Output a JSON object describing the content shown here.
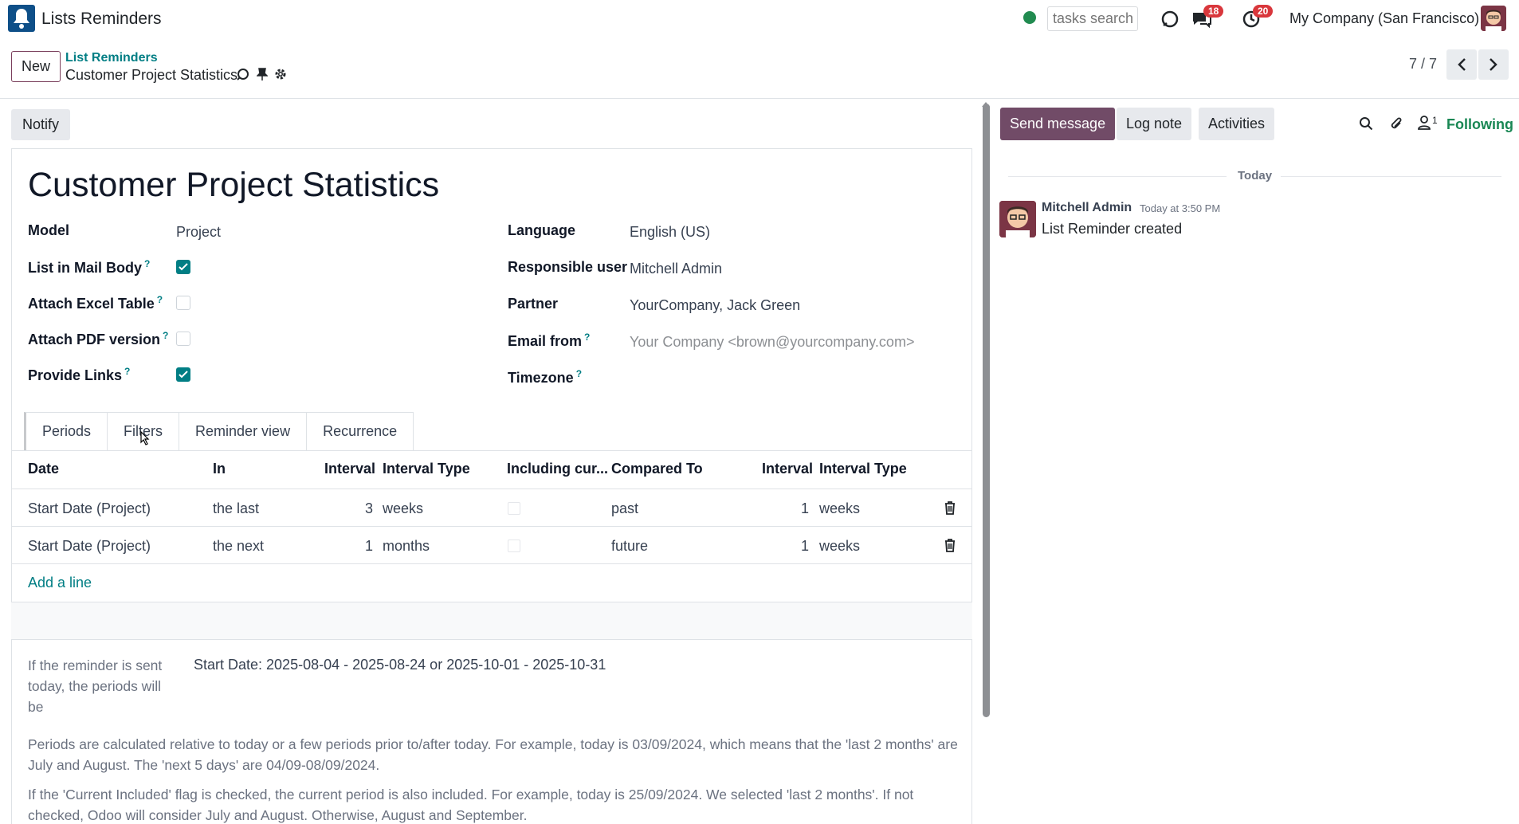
{
  "navbar": {
    "app_title": "Lists Reminders",
    "search_placeholder": "tasks search",
    "messages_badge": "18",
    "activities_badge": "20",
    "company": "My Company (San Francisco)"
  },
  "control_panel": {
    "new_label": "New",
    "breadcrumb_parent": "List Reminders",
    "breadcrumb_current": "Customer Project Statistics",
    "pager": "7 / 7"
  },
  "form": {
    "notify_label": "Notify",
    "title": "Customer Project Statistics",
    "left_fields": [
      {
        "label": "Model",
        "value": "Project",
        "help": ""
      },
      {
        "label": "List in Mail Body",
        "help": "?",
        "checked": true
      },
      {
        "label": "Attach Excel Table",
        "help": "?",
        "checked": false
      },
      {
        "label": "Attach PDF version",
        "help": "?",
        "checked": false
      },
      {
        "label": "Provide Links",
        "help": "?",
        "checked": true
      }
    ],
    "right_fields": [
      {
        "label": "Language",
        "value": "English (US)",
        "help": ""
      },
      {
        "label": "Responsible user",
        "value": "Mitchell Admin",
        "help": ""
      },
      {
        "label": "Partner",
        "value": "YourCompany, Jack Green",
        "help": ""
      },
      {
        "label": "Email from",
        "value": "Your Company <brown@yourcompany.com>",
        "help": "?"
      },
      {
        "label": "Timezone",
        "value": "",
        "help": "?"
      }
    ],
    "tabs": [
      "Periods",
      "Filters",
      "Reminder view",
      "Recurrence"
    ],
    "active_tab": "Periods",
    "table": {
      "headers": [
        "Date",
        "In",
        "Interval",
        "Interval Type",
        "Including cur...",
        "Compared To",
        "Interval",
        "Interval Type"
      ],
      "rows": [
        {
          "date": "Start Date (Project)",
          "in": "the last",
          "interval": "3",
          "interval_type": "weeks",
          "including_current": false,
          "compared_to": "past",
          "interval2": "1",
          "interval_type2": "weeks"
        },
        {
          "date": "Start Date (Project)",
          "in": "the next",
          "interval": "1",
          "interval_type": "months",
          "including_current": false,
          "compared_to": "future",
          "interval2": "1",
          "interval_type2": "weeks"
        }
      ],
      "add_line": "Add a line"
    },
    "preview_label": "If the reminder is sent today, the periods will be",
    "preview_value": "Start Date: 2025-08-04 - 2025-08-24 or 2025-10-01 - 2025-10-31",
    "note1": "Periods are calculated relative to today or a few periods prior to/after today. For example, today is 03/09/2024, which means that the 'last 2 months' are July and August. The 'next 5 days' are 04/09-08/09/2024.",
    "note2": "If the 'Current Included' flag is checked, the current period is also included. For example, today is 25/09/2024. We selected 'last 2 months'. If not checked, Odoo will consider July and August. Otherwise, August and September."
  },
  "chatter": {
    "send_message": "Send message",
    "log_note": "Log note",
    "activities": "Activities",
    "followers_count": "1",
    "following": "Following",
    "date_separator": "Today",
    "message": {
      "author": "Mitchell Admin",
      "time": "Today at 3:50 PM",
      "body": "List Reminder created"
    }
  },
  "colors": {
    "brand": "#714B67",
    "accent": "#017e84",
    "following": "#198754",
    "badge": "#d9373c",
    "status": "#218b50"
  }
}
